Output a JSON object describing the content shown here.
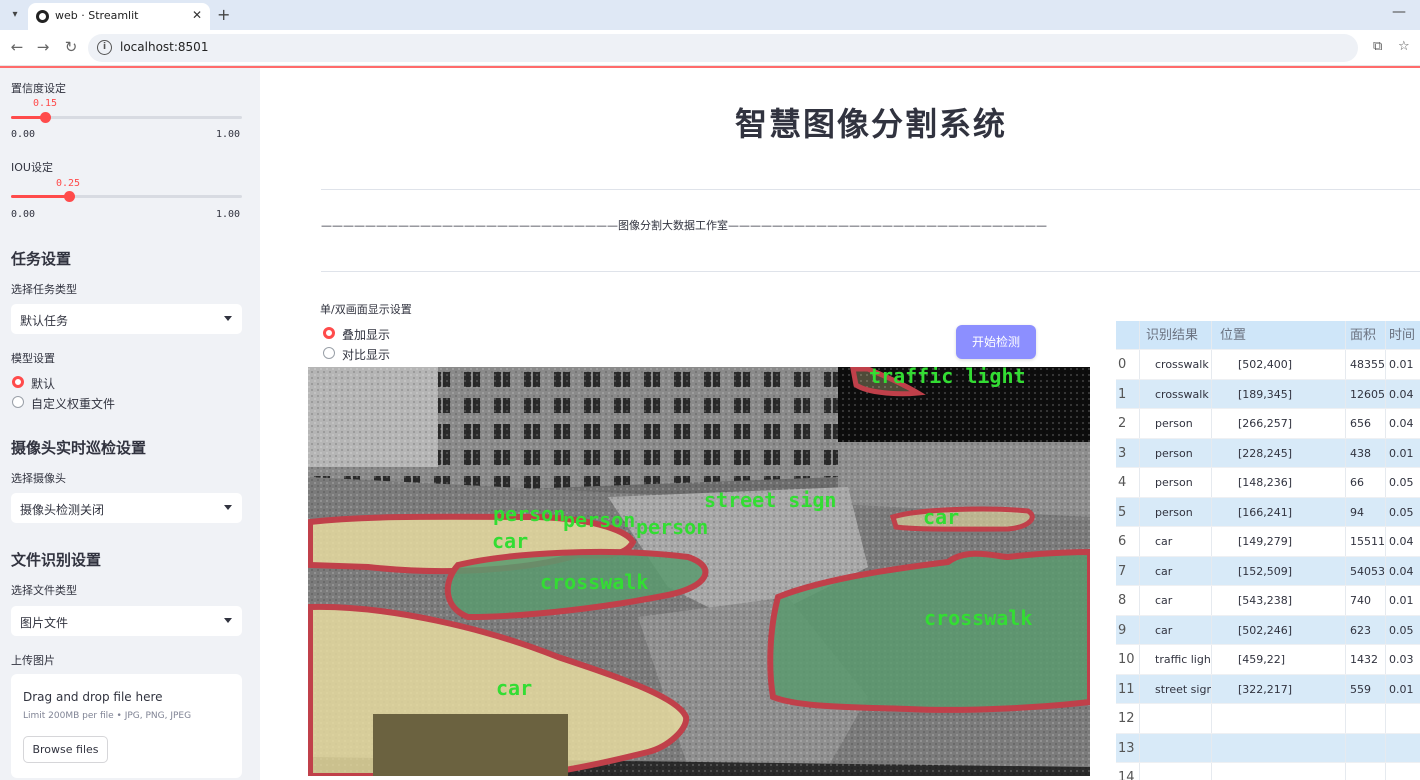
{
  "browser": {
    "tab_title": "web · Streamlit",
    "url": "localhost:8501"
  },
  "sidebar": {
    "confidence": {
      "label": "置信度设定",
      "value": "0.15",
      "value_num": 0.15,
      "min": "0.00",
      "max": "1.00"
    },
    "iou": {
      "label": "IOU设定",
      "value": "0.25",
      "value_num": 0.25,
      "min": "0.00",
      "max": "1.00"
    },
    "task": {
      "heading": "任务设置",
      "select_label": "选择任务类型",
      "selected": "默认任务"
    },
    "model": {
      "label": "模型设置",
      "options": [
        "默认",
        "自定义权重文件"
      ],
      "selected_index": 0
    },
    "camera": {
      "heading": "摄像头实时巡检设置",
      "select_label": "选择摄像头",
      "selected": "摄像头检测关闭"
    },
    "file": {
      "heading": "文件识别设置",
      "select_label": "选择文件类型",
      "selected": "图片文件",
      "upload_label": "上传图片"
    },
    "uploader": {
      "title": "Drag and drop file here",
      "limit": "Limit 200MB per file • JPG, PNG, JPEG",
      "button": "Browse files"
    }
  },
  "main": {
    "title": "智慧图像分割系统",
    "subtitle": "———————————————————————————图像分割大数据工作室—————————————————————————————",
    "display_mode_label": "单/双画面显示设置",
    "display_modes": [
      "叠加显示",
      "对比显示"
    ],
    "display_mode_selected": 0,
    "detect_button": "开始检测"
  },
  "image_labels": [
    "traffic light",
    "street sign",
    "person",
    "person",
    "person",
    "car",
    "car",
    "crosswalk",
    "crosswalk",
    "car"
  ],
  "table": {
    "columns": [
      "识别结果",
      "位置",
      "面积",
      "时间"
    ],
    "rows": [
      {
        "idx": "0",
        "result": "crosswalk",
        "pos": "[502,400]",
        "area": "48355",
        "time": "0.01"
      },
      {
        "idx": "1",
        "result": "crosswalk",
        "pos": "[189,345]",
        "area": "12605",
        "time": "0.04"
      },
      {
        "idx": "2",
        "result": "person",
        "pos": "[266,257]",
        "area": "656",
        "time": "0.04"
      },
      {
        "idx": "3",
        "result": "person",
        "pos": "[228,245]",
        "area": "438",
        "time": "0.01"
      },
      {
        "idx": "4",
        "result": "person",
        "pos": "[148,236]",
        "area": "66",
        "time": "0.05"
      },
      {
        "idx": "5",
        "result": "person",
        "pos": "[166,241]",
        "area": "94",
        "time": "0.05"
      },
      {
        "idx": "6",
        "result": "car",
        "pos": "[149,279]",
        "area": "15511",
        "time": "0.04"
      },
      {
        "idx": "7",
        "result": "car",
        "pos": "[152,509]",
        "area": "54053",
        "time": "0.04"
      },
      {
        "idx": "8",
        "result": "car",
        "pos": "[543,238]",
        "area": "740",
        "time": "0.01"
      },
      {
        "idx": "9",
        "result": "car",
        "pos": "[502,246]",
        "area": "623",
        "time": "0.05"
      },
      {
        "idx": "10",
        "result": "traffic light",
        "pos": "[459,22]",
        "area": "1432",
        "time": "0.03"
      },
      {
        "idx": "11",
        "result": "street sign",
        "pos": "[322,217]",
        "area": "559",
        "time": "0.01"
      },
      {
        "idx": "12",
        "result": "",
        "pos": "",
        "area": "",
        "time": ""
      },
      {
        "idx": "13",
        "result": "",
        "pos": "",
        "area": "",
        "time": ""
      },
      {
        "idx": "14",
        "result": "",
        "pos": "",
        "area": "",
        "time": ""
      }
    ]
  },
  "colors": {
    "accent": "#ff4b4b",
    "button": "#8c8fff",
    "sidebar_bg": "#f0f2f6",
    "mask_outline": "#c0404a",
    "mask_car": "#e8dca0",
    "mask_crosswalk": "#5a9a6e",
    "label_text": "#33dd33"
  }
}
